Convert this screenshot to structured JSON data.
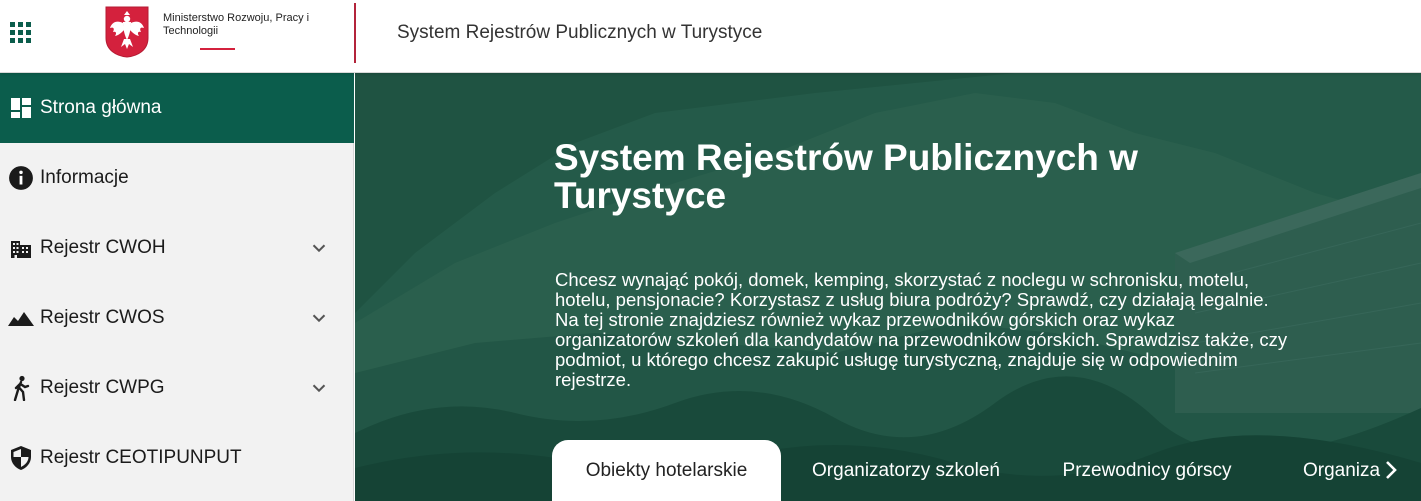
{
  "header": {
    "ministry_name": "Ministerstwo Rozwoju, Pracy i Technologii",
    "title": "System Rejestrów Publicznych w Turystyce"
  },
  "sidebar": {
    "items": [
      {
        "label": "Strona główna",
        "icon": "dashboard-icon",
        "active": true
      },
      {
        "label": "Informacje",
        "icon": "info-icon"
      },
      {
        "label": "Rejestr CWOH",
        "icon": "building-icon",
        "expandable": true
      },
      {
        "label": "Rejestr CWOS",
        "icon": "mountain-icon",
        "expandable": true
      },
      {
        "label": "Rejestr CWPG",
        "icon": "hiker-icon",
        "expandable": true
      },
      {
        "label": "Rejestr CEOTIPUNPUT",
        "icon": "shield-icon"
      }
    ]
  },
  "hero": {
    "title": "System Rejestrów Publicznych w Turystyce",
    "text": "Chcesz wynająć pokój, domek, kemping, skorzystać z noclegu w schronisku, motelu, hotelu, pensjonacie? Korzystasz z usług biura podróży? Sprawdź, czy działają legalnie. Na tej stronie znajdziesz również wykaz przewodników górskich oraz wykaz organizatorów szkoleń dla kandydatów na przewodników górskich. Sprawdzisz także, czy podmiot, u którego chcesz zakupić usługę turystyczną, znajduje się w odpowiednim rejestrze."
  },
  "tabs": [
    {
      "label": "Obiekty hotelarskie",
      "active": true
    },
    {
      "label": "Organizatorzy szkoleń"
    },
    {
      "label": "Przewodnicy górscy"
    },
    {
      "label": "Organiza"
    }
  ],
  "colors": {
    "brand_green": "#0b5d4c",
    "accent_red": "#d4213d",
    "sidebar_bg": "#f2f2f2"
  }
}
